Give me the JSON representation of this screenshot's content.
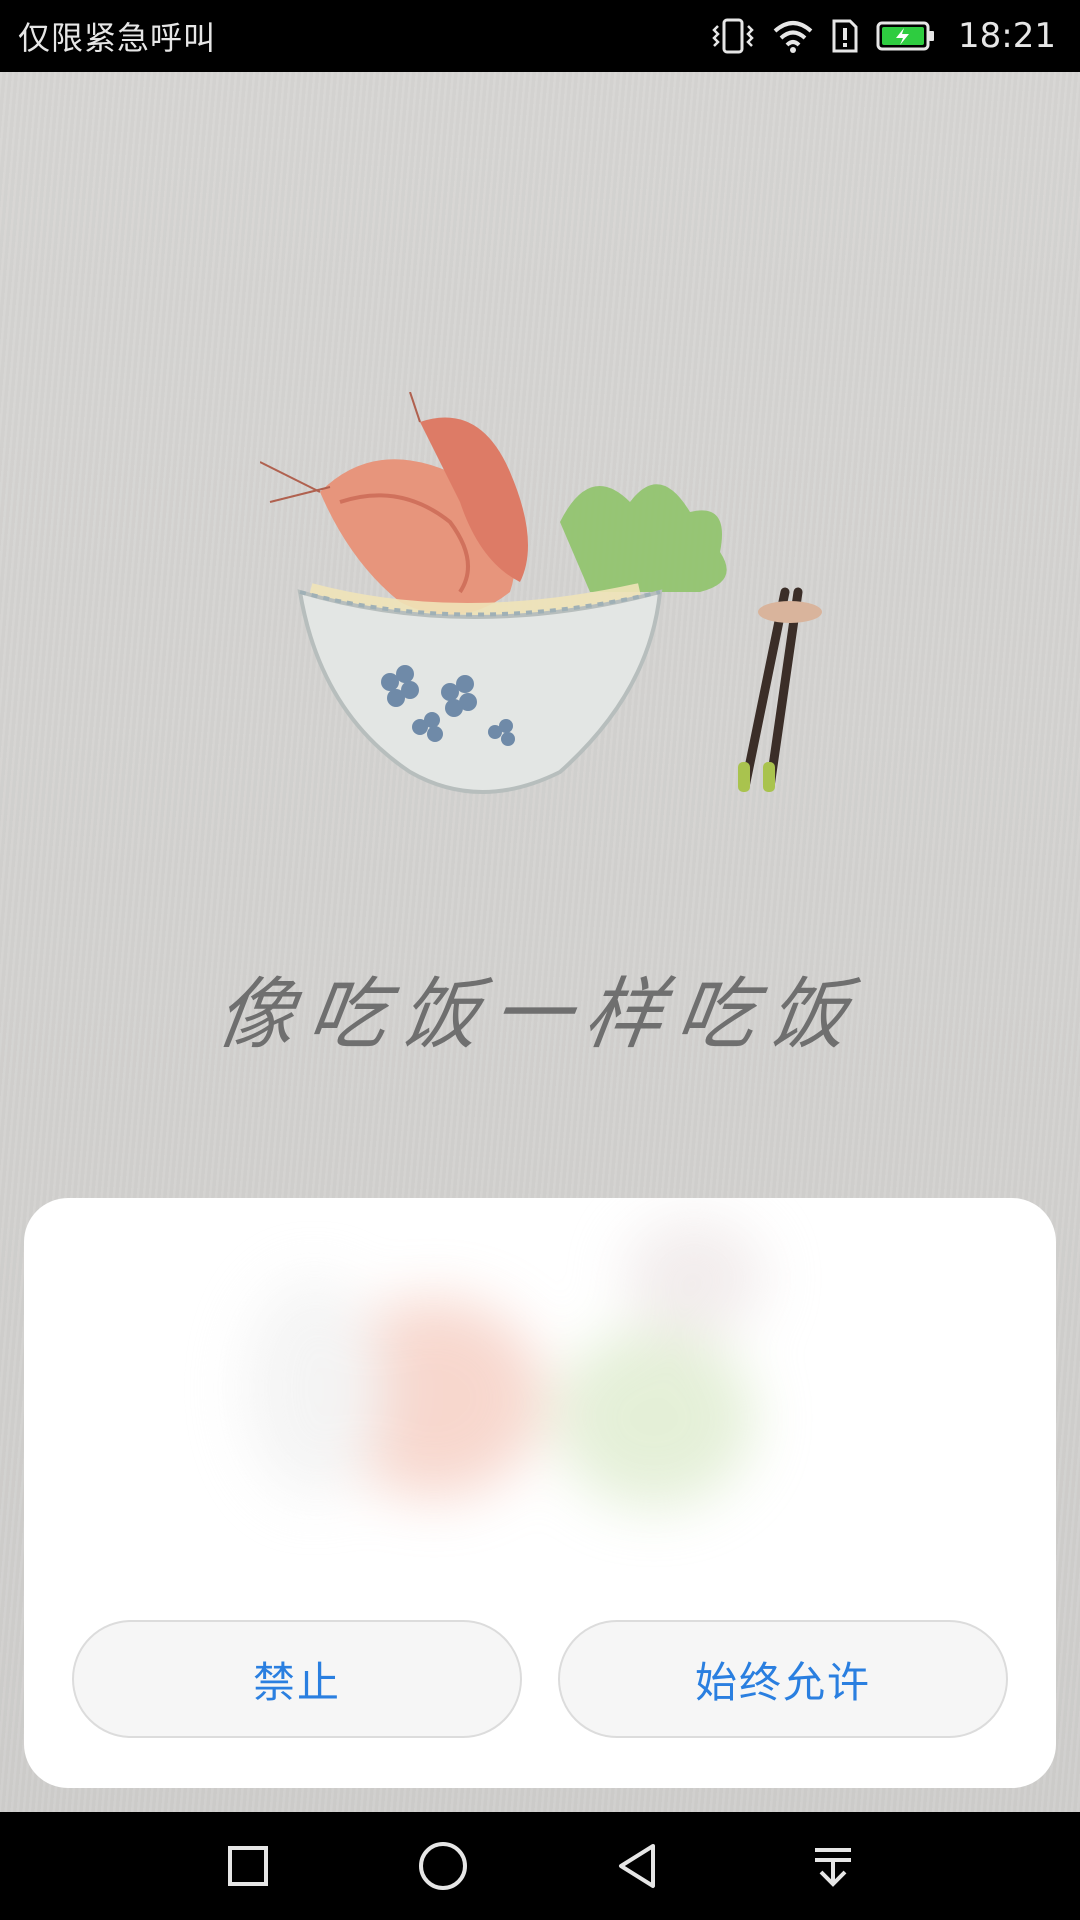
{
  "status_bar": {
    "carrier_text": "仅限紧急呼叫",
    "time": "18:21",
    "icons": [
      "vibrate-icon",
      "wifi-icon",
      "sim-alert-icon",
      "battery-charging-icon"
    ],
    "battery_color": "#2ecc40"
  },
  "splash": {
    "slogan": "像吃饭一样吃饭",
    "illustration": "shrimp-noodle-bowl-with-chopsticks"
  },
  "dialog": {
    "deny_label": "禁止",
    "allow_label": "始终允许",
    "accent_color": "#2a7fe0"
  },
  "nav_bar": {
    "buttons": [
      "recent-apps-icon",
      "home-icon",
      "back-icon",
      "notification-pulldown-icon"
    ]
  }
}
